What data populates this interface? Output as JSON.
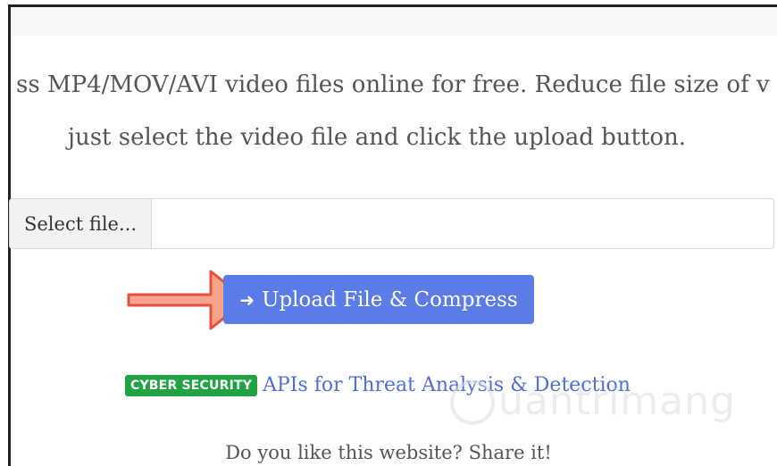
{
  "page": {
    "description_line1": "ss MP4/MOV/AVI video files online for free. Reduce file size of v",
    "description_line2": "just select the video file and click the upload button."
  },
  "file_input": {
    "select_label": "Select file...",
    "selected_value": ""
  },
  "upload_button": {
    "icon": "arrow-right-icon",
    "label": "Upload File & Compress",
    "color": "#5b7be6"
  },
  "ad": {
    "badge": "CYBER SECURITY",
    "badge_color": "#21a344",
    "link_text": "APIs for Threat Analysis & Detection"
  },
  "footer": {
    "share_text": "Do you like this website? Share it!"
  },
  "watermark": {
    "text": "uantrimang"
  },
  "annotation": {
    "pointer": "red-arrow-icon",
    "color": "#e8503a"
  }
}
